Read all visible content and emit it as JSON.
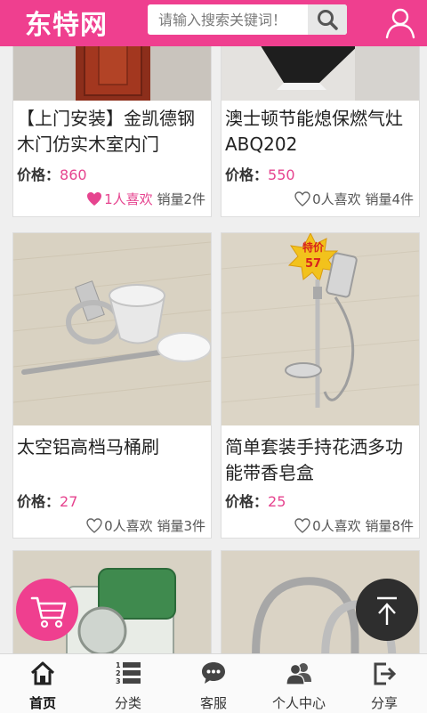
{
  "header": {
    "logo": "东特网",
    "search_placeholder": "请输入搜索关键词！",
    "search_icon": "search-icon",
    "user_icon": "user-icon"
  },
  "products": [
    {
      "title": "【上门安装】金凯德钢木门仿实木室内门",
      "price_label": "价格：",
      "price": "860",
      "likes": "1人喜欢",
      "liked": true,
      "sales": "销量2件"
    },
    {
      "title": "澳士顿节能熄保燃气灶ABQ202",
      "price_label": "价格：",
      "price": "550",
      "likes": "0人喜欢",
      "liked": false,
      "sales": "销量4件"
    },
    {
      "title": "太空铝高档马桶刷",
      "price_label": "价格：",
      "price": "27",
      "likes": "0人喜欢",
      "liked": false,
      "sales": "销量3件"
    },
    {
      "title": "简单套装手持花洒多功能带香皂盒",
      "price_label": "价格：",
      "price": "25",
      "likes": "0人喜欢",
      "liked": false,
      "sales": "销量8件",
      "image_sticker": "特价",
      "image_sticker_num": "57"
    }
  ],
  "fab": {
    "cart_icon": "cart-icon",
    "top_icon": "arrow-up-icon"
  },
  "tabbar": {
    "items": [
      {
        "label": "首页",
        "icon": "home-icon",
        "active": true
      },
      {
        "label": "分类",
        "icon": "list-icon",
        "active": false
      },
      {
        "label": "客服",
        "icon": "chat-icon",
        "active": false
      },
      {
        "label": "个人中心",
        "icon": "users-icon",
        "active": false
      },
      {
        "label": "分享",
        "icon": "share-icon",
        "active": false
      }
    ]
  },
  "colors": {
    "brand": "#ef3f8f",
    "price": "#e6448f",
    "tabbar_bg": "#fafafa"
  }
}
